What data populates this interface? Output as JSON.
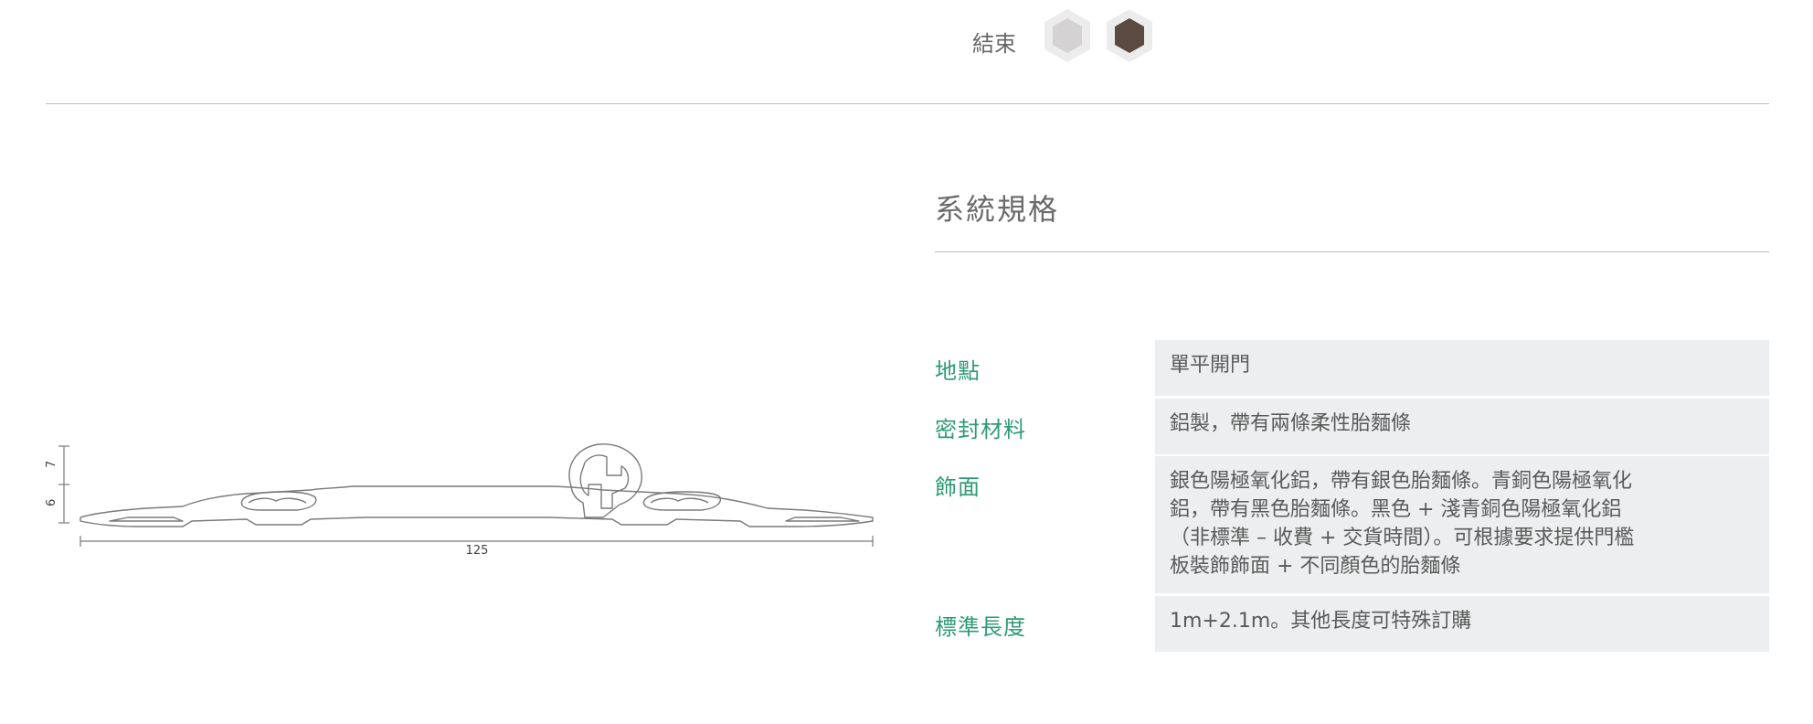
{
  "finish": {
    "label": "結束",
    "swatches": [
      {
        "name": "silver",
        "color": "#d4d2d3"
      },
      {
        "name": "bronze",
        "color": "#5a4a40"
      }
    ]
  },
  "specs": {
    "title": "系統規格",
    "rows": [
      {
        "label": "地點",
        "value": "單平開門"
      },
      {
        "label": "密封材料",
        "value": "鋁製，帶有兩條柔性胎麵條"
      },
      {
        "label": "飾面",
        "lines": [
          "銀色陽極氧化鋁，帶有銀色胎麵條。青銅色陽極氧化",
          "鋁，帶有黑色胎麵條。黑色 + 淺青銅色陽極氧化鋁",
          "（非標準 – 收費 + 交貨時間）。可根據要求提供門檻",
          "板裝飾飾面 + 不同顏色的胎麵條"
        ]
      },
      {
        "label": "標準長度",
        "value": "1m+2.1m。其他長度可特殊訂購"
      }
    ]
  },
  "drawing": {
    "dims": {
      "height_top": "7",
      "height_bottom": "6",
      "width": "125"
    }
  },
  "colors": {
    "accent": "#2e9b74",
    "cell_bg": "#eceeef",
    "rule": "#bdbdbd"
  }
}
